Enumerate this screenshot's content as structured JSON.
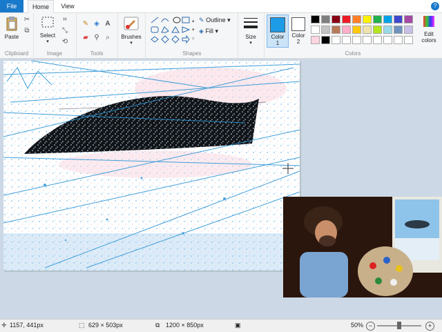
{
  "tabs": {
    "file": "File",
    "home": "Home",
    "view": "View",
    "help": "?"
  },
  "clipboard": {
    "paste": "Paste",
    "label": "Clipboard"
  },
  "image": {
    "select": "Select",
    "label": "Image"
  },
  "tools": {
    "label": "Tools"
  },
  "brushes": {
    "label": "Brushes"
  },
  "shapes": {
    "label": "Shapes",
    "outline": "Outline",
    "fill": "Fill"
  },
  "size": {
    "label": "Size"
  },
  "colors": {
    "color1_label": "Color\n1",
    "color2_label": "Color\n2",
    "label": "Colors",
    "edit_label": "Edit\ncolors",
    "color1": "#1e9be6",
    "color2": "#ffffff",
    "palette": [
      "#000000",
      "#7f7f7f",
      "#880015",
      "#ed1c24",
      "#ff7f27",
      "#fff200",
      "#22b14c",
      "#00a2e8",
      "#3f48cc",
      "#a349a4",
      "#ffffff",
      "#c3c3c3",
      "#b97a57",
      "#ffaec9",
      "#ffc90e",
      "#efe4b0",
      "#b5e61d",
      "#99d9ea",
      "#7092be",
      "#c8bfe7",
      "#fcd5e0",
      "#000000",
      "#ffffff",
      "#ffffff",
      "#ffffff",
      "#ffffff",
      "#ffffff",
      "#ffffff",
      "#ffffff",
      "#ffffff"
    ]
  },
  "status": {
    "cursor": "1157, 441px",
    "selection": "629 × 503px",
    "image_size": "1200 × 850px",
    "zoom": "50%",
    "zoom_level": 0.5
  }
}
